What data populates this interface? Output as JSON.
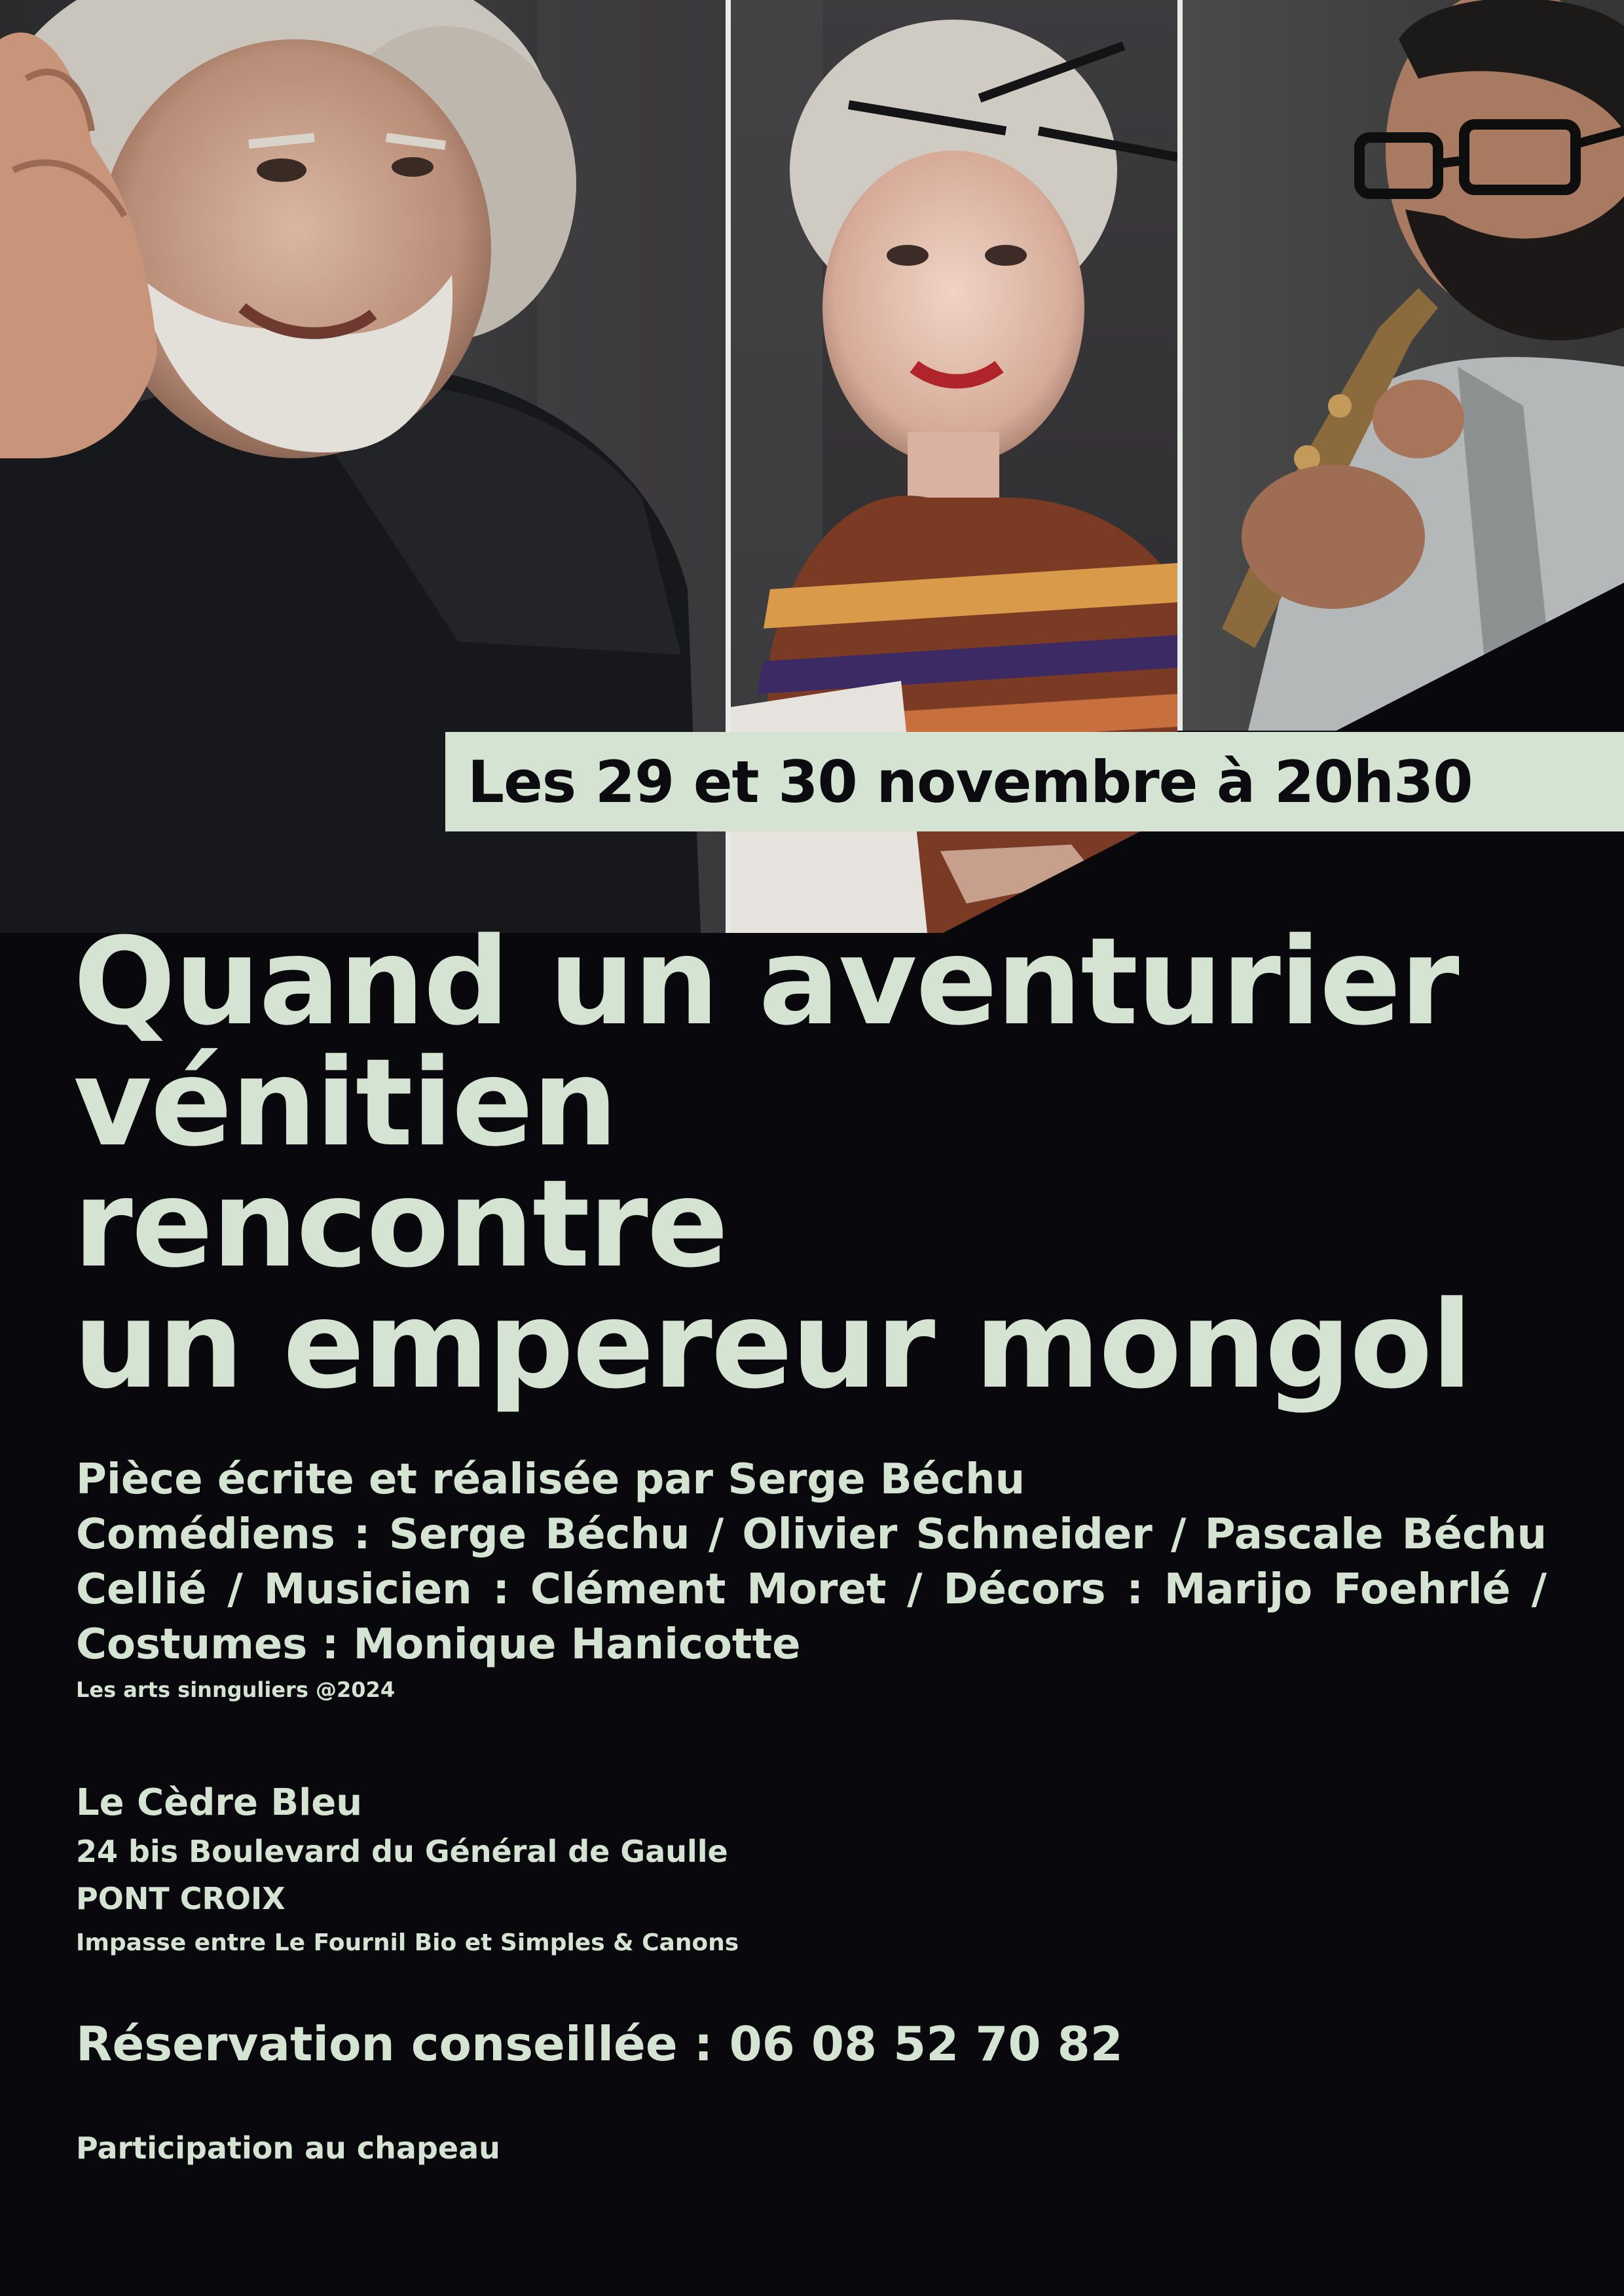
{
  "date_banner": "Les 29 et 30 novembre à 20h30",
  "title_lines": [
    "Quand un aventurier",
    "vénitien",
    "rencontre",
    "un empereur mongol"
  ],
  "credits": {
    "author": "Pièce écrite et réalisée par Serge Béchu",
    "cast": "Comédiens : Serge Béchu / Olivier Schneider / Pascale Béchu Cellié / Musicien : Clément Moret / Décors : Marijo Foehrlé / Costumes : Monique Hanicotte",
    "copyright": "Les arts sinnguliers @2024"
  },
  "venue": {
    "name": "Le Cèdre Bleu",
    "address": "24 bis Boulevard du Général de Gaulle",
    "city": "PONT CROIX",
    "note": "Impasse entre Le Fournil Bio et Simples & Canons"
  },
  "reservation": "Réservation conseillée : 06 08 52 70 82",
  "participation": "Participation au chapeau",
  "colors": {
    "background": "#09080c",
    "accent": "#d5e4d2",
    "banner_text": "#0b0b10"
  }
}
